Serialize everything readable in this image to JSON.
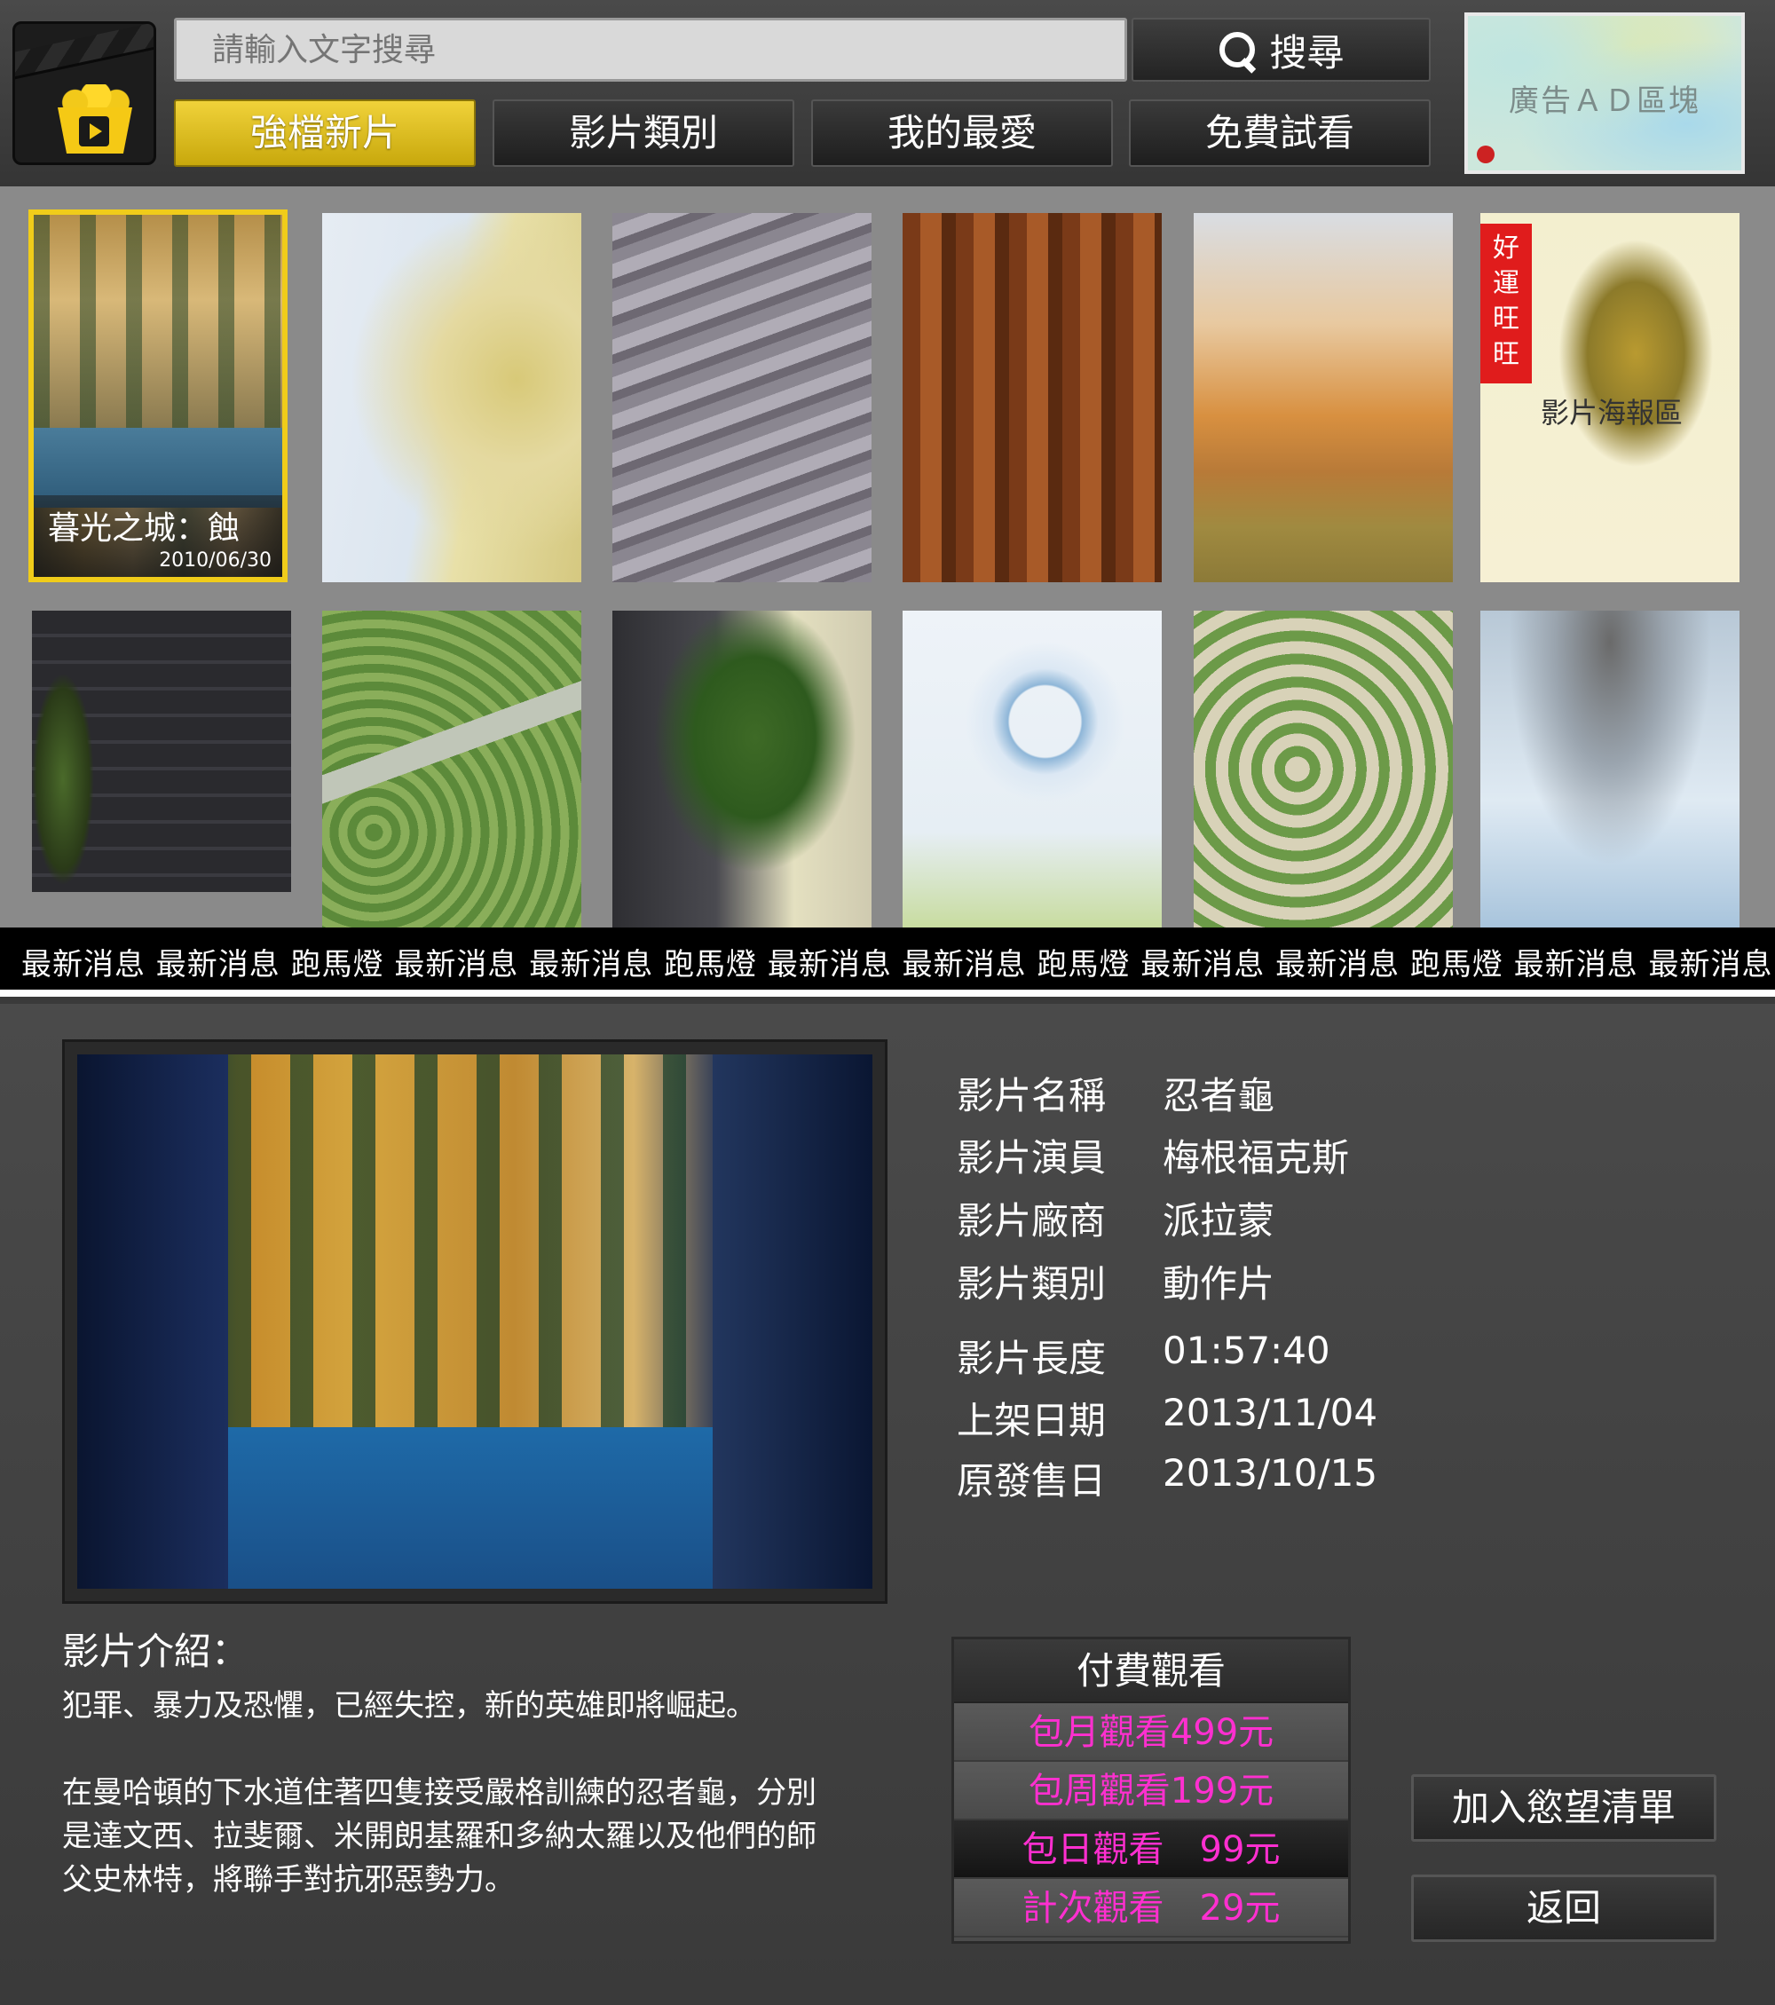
{
  "search": {
    "placeholder": "請輸入文字搜尋",
    "button_label": "搜尋"
  },
  "nav": {
    "tabs": [
      {
        "label": "強檔新片",
        "active": true
      },
      {
        "label": "影片類別",
        "active": false
      },
      {
        "label": "我的最愛",
        "active": false
      },
      {
        "label": "免費試看",
        "active": false
      }
    ]
  },
  "ad": {
    "label": "廣告ＡＤ區塊"
  },
  "posters": {
    "selected": {
      "title": "暮光之城：蝕",
      "date": "2010/06/30"
    },
    "pineapple": {
      "tag": "好運旺旺",
      "caption": "影片海報區"
    }
  },
  "ticker": {
    "text": "最新消息 最新消息 跑馬燈 最新消息 最新消息 跑馬燈 最新消息 最新消息 跑馬燈 最新消息 最新消息 跑馬燈 最新消息 最新消息 跑馬燈"
  },
  "detail": {
    "fields": [
      {
        "label": "影片名稱",
        "value": "忍者龜"
      },
      {
        "label": "影片演員",
        "value": "梅根福克斯"
      },
      {
        "label": "影片廠商",
        "value": "派拉蒙"
      },
      {
        "label": "影片類別",
        "value": "動作片"
      },
      {
        "label": "影片長度",
        "value": "01:57:40"
      },
      {
        "label": "上架日期",
        "value": "2013/11/04"
      },
      {
        "label": "原發售日",
        "value": "2013/10/15"
      }
    ],
    "intro_heading": "影片介紹：",
    "intro_lines": [
      "犯罪、暴力及恐懼，已經失控，新的英雄即將崛起。",
      "在曼哈頓的下水道住著四隻接受嚴格訓練的忍者龜，分別",
      "是達文西、拉斐爾、米開朗基羅和多納太羅以及他們的師",
      "父史林特，將聯手對抗邪惡勢力。"
    ]
  },
  "payment": {
    "header": "付費觀看",
    "options": [
      "包月觀看499元",
      "包周觀看199元",
      "包日觀看　99元",
      "計次觀看　29元"
    ]
  },
  "actions": {
    "wishlist": "加入慾望清單",
    "back": "返回"
  },
  "colors": {
    "accent": "#f0cc1a",
    "price_text": "#ff2fd0",
    "ticker_bg": "#000000"
  }
}
